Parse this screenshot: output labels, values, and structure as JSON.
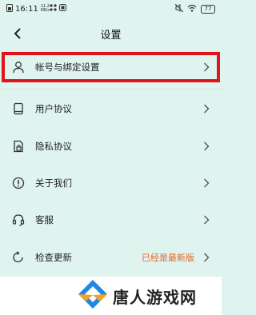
{
  "status_bar": {
    "time": "16:11",
    "small_text": "11.2 KB/s",
    "battery": "77"
  },
  "header": {
    "title": "设置"
  },
  "settings_items": [
    {
      "label": "帐号与绑定设置",
      "icon": "person-icon",
      "value": ""
    },
    {
      "label": "用户协议",
      "icon": "book-icon",
      "value": ""
    },
    {
      "label": "隐私协议",
      "icon": "lock-document-icon",
      "value": ""
    },
    {
      "label": "关于我们",
      "icon": "info-icon",
      "value": ""
    },
    {
      "label": "客服",
      "icon": "headset-icon",
      "value": ""
    },
    {
      "label": "检查更新",
      "icon": "refresh-icon",
      "value": "已经是最新版"
    }
  ],
  "watermark": {
    "text": "唐人游戏网"
  },
  "colors": {
    "background": "#dff3ef",
    "highlight_border": "#e0141b",
    "update_status": "#e8672a",
    "logo_blue": "#1e88e5",
    "logo_orange": "#f5a020"
  }
}
